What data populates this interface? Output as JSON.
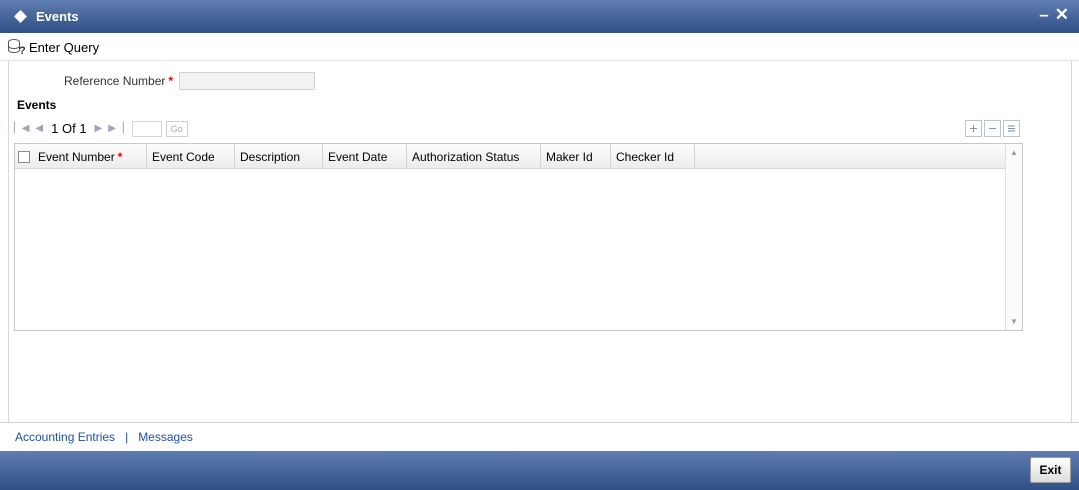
{
  "window": {
    "title": "Events",
    "title_icon": "diamond-icon",
    "minimize_label": "–",
    "close_label": "✕"
  },
  "toolbar": {
    "enter_query_label": "Enter Query",
    "enter_query_icon": "query-icon"
  },
  "form": {
    "reference_number_label": "Reference Number",
    "required_marker": "*",
    "reference_number_value": ""
  },
  "events_section": {
    "title": "Events",
    "pagination": {
      "current_page": "1",
      "of_label": "Of",
      "total_pages": "1",
      "go_label": "Go"
    },
    "row_actions": {
      "add_label": "+",
      "delete_label": "−",
      "view_label": "≡"
    },
    "columns": [
      {
        "label": "Event Number",
        "required": "*"
      },
      {
        "label": "Event Code"
      },
      {
        "label": "Description"
      },
      {
        "label": "Event Date"
      },
      {
        "label": "Authorization Status"
      },
      {
        "label": "Maker Id"
      },
      {
        "label": "Checker Id"
      }
    ],
    "rows": []
  },
  "footer": {
    "links": [
      "Accounting Entries",
      "Messages"
    ],
    "separator": "|"
  },
  "actions": {
    "exit_label": "Exit"
  },
  "colors": {
    "titlebar": "#2f4f86",
    "link": "#1f4fa8",
    "required": "#e00000"
  }
}
